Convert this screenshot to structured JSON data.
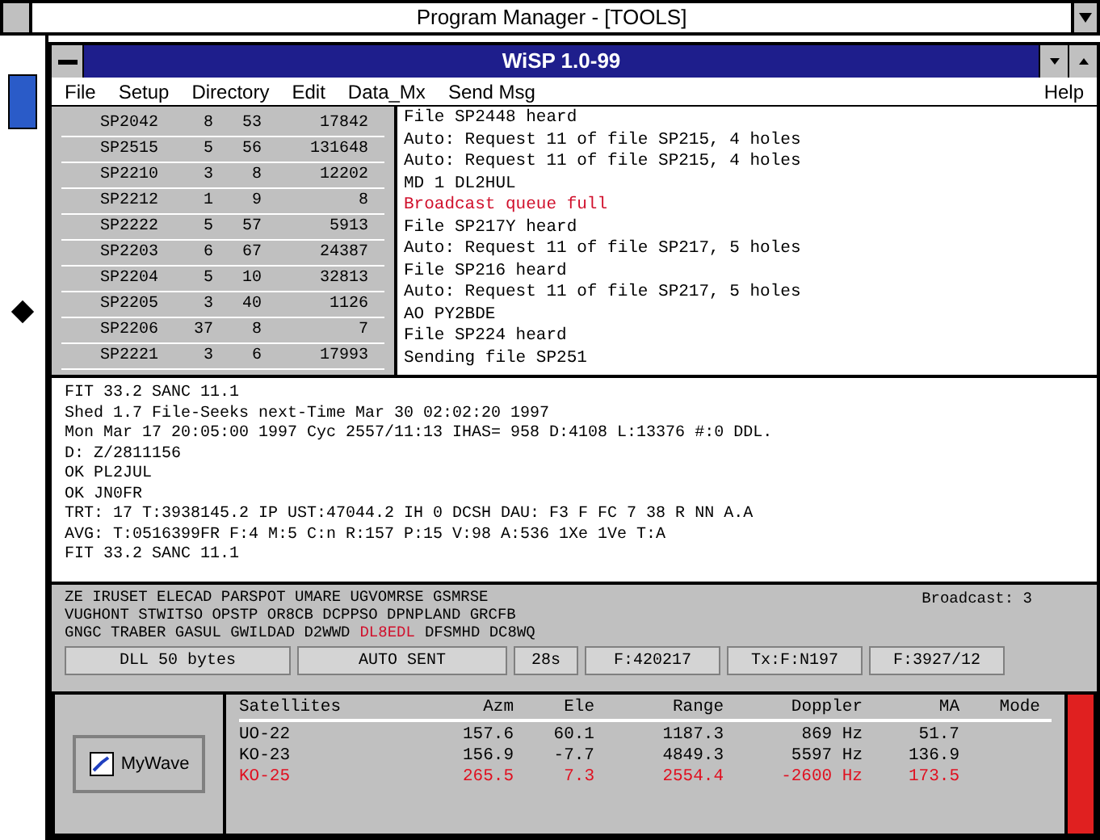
{
  "program_manager": {
    "title": "Program Manager - [TOOLS]"
  },
  "window": {
    "title": "WiSP 1.0-99"
  },
  "menu": [
    "File",
    "Setup",
    "Directory",
    "Edit",
    "Data_Mx",
    "Send Msg"
  ],
  "help_menu": "Help",
  "files": [
    {
      "cells": [
        "SP2042",
        "8",
        "53",
        "17842"
      ]
    },
    {
      "cells": [
        "SP2515",
        "5",
        "56",
        "131648"
      ]
    },
    {
      "cells": [
        "SP2210",
        "3",
        "8",
        "12202"
      ]
    },
    {
      "cells": [
        "SP2212",
        "1",
        "9",
        "8"
      ]
    },
    {
      "cells": [
        "SP2222",
        "5",
        "57",
        "5913"
      ]
    },
    {
      "cells": [
        "SP2203",
        "6",
        "67",
        "24387"
      ]
    },
    {
      "cells": [
        "SP2204",
        "5",
        "10",
        "32813"
      ]
    },
    {
      "cells": [
        "SP2205",
        "3",
        "40",
        "1126"
      ]
    },
    {
      "cells": [
        "SP2206",
        "37",
        "8",
        "7"
      ]
    },
    {
      "cells": [
        "SP2221",
        "3",
        "6",
        "17993"
      ]
    }
  ],
  "messages": [
    {
      "text": "File SP2448 heard",
      "kind": "normal"
    },
    {
      "text": "Auto: Request 11 of file SP215, 4 holes",
      "kind": "normal"
    },
    {
      "text": "Auto: Request 11 of file SP215, 4 holes",
      "kind": "normal"
    },
    {
      "text": "MD 1 DL2HUL",
      "kind": "normal"
    },
    {
      "text": "Broadcast queue full",
      "kind": "alert"
    },
    {
      "text": "File SP217Y heard",
      "kind": "normal"
    },
    {
      "text": "Auto: Request 11 of file SP217, 5 holes",
      "kind": "normal"
    },
    {
      "text": "File SP216 heard",
      "kind": "normal"
    },
    {
      "text": "Auto: Request 11 of file SP217, 5 holes",
      "kind": "normal"
    },
    {
      "text": "AO PY2BDE",
      "kind": "normal"
    },
    {
      "text": "File SP224 heard",
      "kind": "normal"
    },
    {
      "text": "Sending file SP251",
      "kind": "normal"
    }
  ],
  "log": [
    "FIT 33.2 SANC 11.1",
    "Shed 1.7 File-Seeks next-Time Mar 30 02:02:20 1997",
    "Mon Mar 17 20:05:00 1997 Cyc 2557/11:13 IHAS= 958 D:4108 L:13376 #:0 DDL.",
    "D: Z/2811156",
    "OK PL2JUL",
    "OK JN0FR",
    "TRT: 17 T:3938145.2 IP UST:47044.2 IH 0 DCSH DAU: F3 F FC 7 38 R NN A.A",
    "AVG: T:0516399FR F:4 M:5 C:n R:157 P:15 V:98 A:536 1Xe 1Ve T:A",
    "FIT 33.2 SANC 11.1"
  ],
  "callsigns": [
    [
      {
        "text": "ZE IRUSET ELECAD PARSPOT UMARE UGVOMRSE GSMRSE",
        "kind": "normal"
      }
    ],
    [
      {
        "text": "VUGHONT STWITSO OPSTP OR8CB DCPPSO DPNPLAND GRCFB",
        "kind": "normal"
      }
    ],
    [
      {
        "text": "GNGC TRABER GASUL GWILDAD D2WWD",
        "kind": "normal"
      },
      {
        "text": "DL8EDL",
        "kind": "alert"
      },
      {
        "text": "DFSMHD DC8WQ",
        "kind": "normal"
      }
    ]
  ],
  "broadcast": "Broadcast: 3",
  "status_bar": [
    "DLL 50 bytes",
    "AUTO SENT",
    "28s",
    "F:420217",
    "Tx:F:N197",
    "F:3927/12"
  ],
  "taskbar_button": "MyWave",
  "satellites": {
    "columns": [
      "Satellites",
      "Azm",
      "Ele",
      "Range",
      "Doppler",
      "MA",
      "Mode"
    ],
    "rows": [
      {
        "cells": [
          "UO-22",
          "157.6",
          "60.1",
          "1187.3",
          "869 Hz",
          "51.7"
        ],
        "alert": false
      },
      {
        "cells": [
          "KO-23",
          "156.9",
          "-7.7",
          "4849.3",
          "5597 Hz",
          "136.9"
        ],
        "alert": false
      },
      {
        "cells": [
          "KO-25",
          "265.5",
          "7.3",
          "2554.4",
          "-2600 Hz",
          "173.5"
        ],
        "alert": true
      }
    ]
  }
}
